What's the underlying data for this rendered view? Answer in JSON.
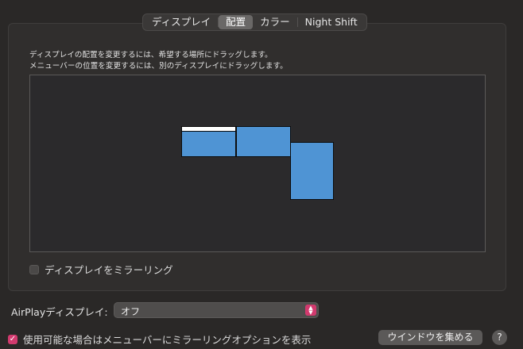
{
  "tabs": [
    {
      "label": "ディスプレイ",
      "selected": false
    },
    {
      "label": "配置",
      "selected": true
    },
    {
      "label": "カラー",
      "selected": false
    },
    {
      "label": "Night Shift",
      "selected": false
    }
  ],
  "instructions": {
    "line1": "ディスプレイの配置を変更するには、希望する場所にドラッグします。",
    "line2": "メニューバーの位置を変更するには、別のディスプレイにドラッグします。"
  },
  "arrangement": {
    "displays": [
      {
        "name": "main-display",
        "has_menu_bar": true
      },
      {
        "name": "second-display",
        "has_menu_bar": false
      },
      {
        "name": "third-display",
        "has_menu_bar": false
      }
    ]
  },
  "mirror": {
    "label": "ディスプレイをミラーリング",
    "checked": false
  },
  "airplay": {
    "label": "AirPlayディスプレイ:",
    "value": "オフ"
  },
  "menubar_option": {
    "label": "使用可能な場合はメニューバーにミラーリングオプションを表示",
    "checked": true
  },
  "gather_button": {
    "label": "ウインドウを集める"
  },
  "help": {
    "label": "?"
  },
  "colors": {
    "accent": "#d23a6e",
    "display_fill": "#4f94d4",
    "background": "#2a2827"
  },
  "icons": {
    "checkmark": "checkmark-icon",
    "select_arrows": "updown-chevron-icon"
  }
}
